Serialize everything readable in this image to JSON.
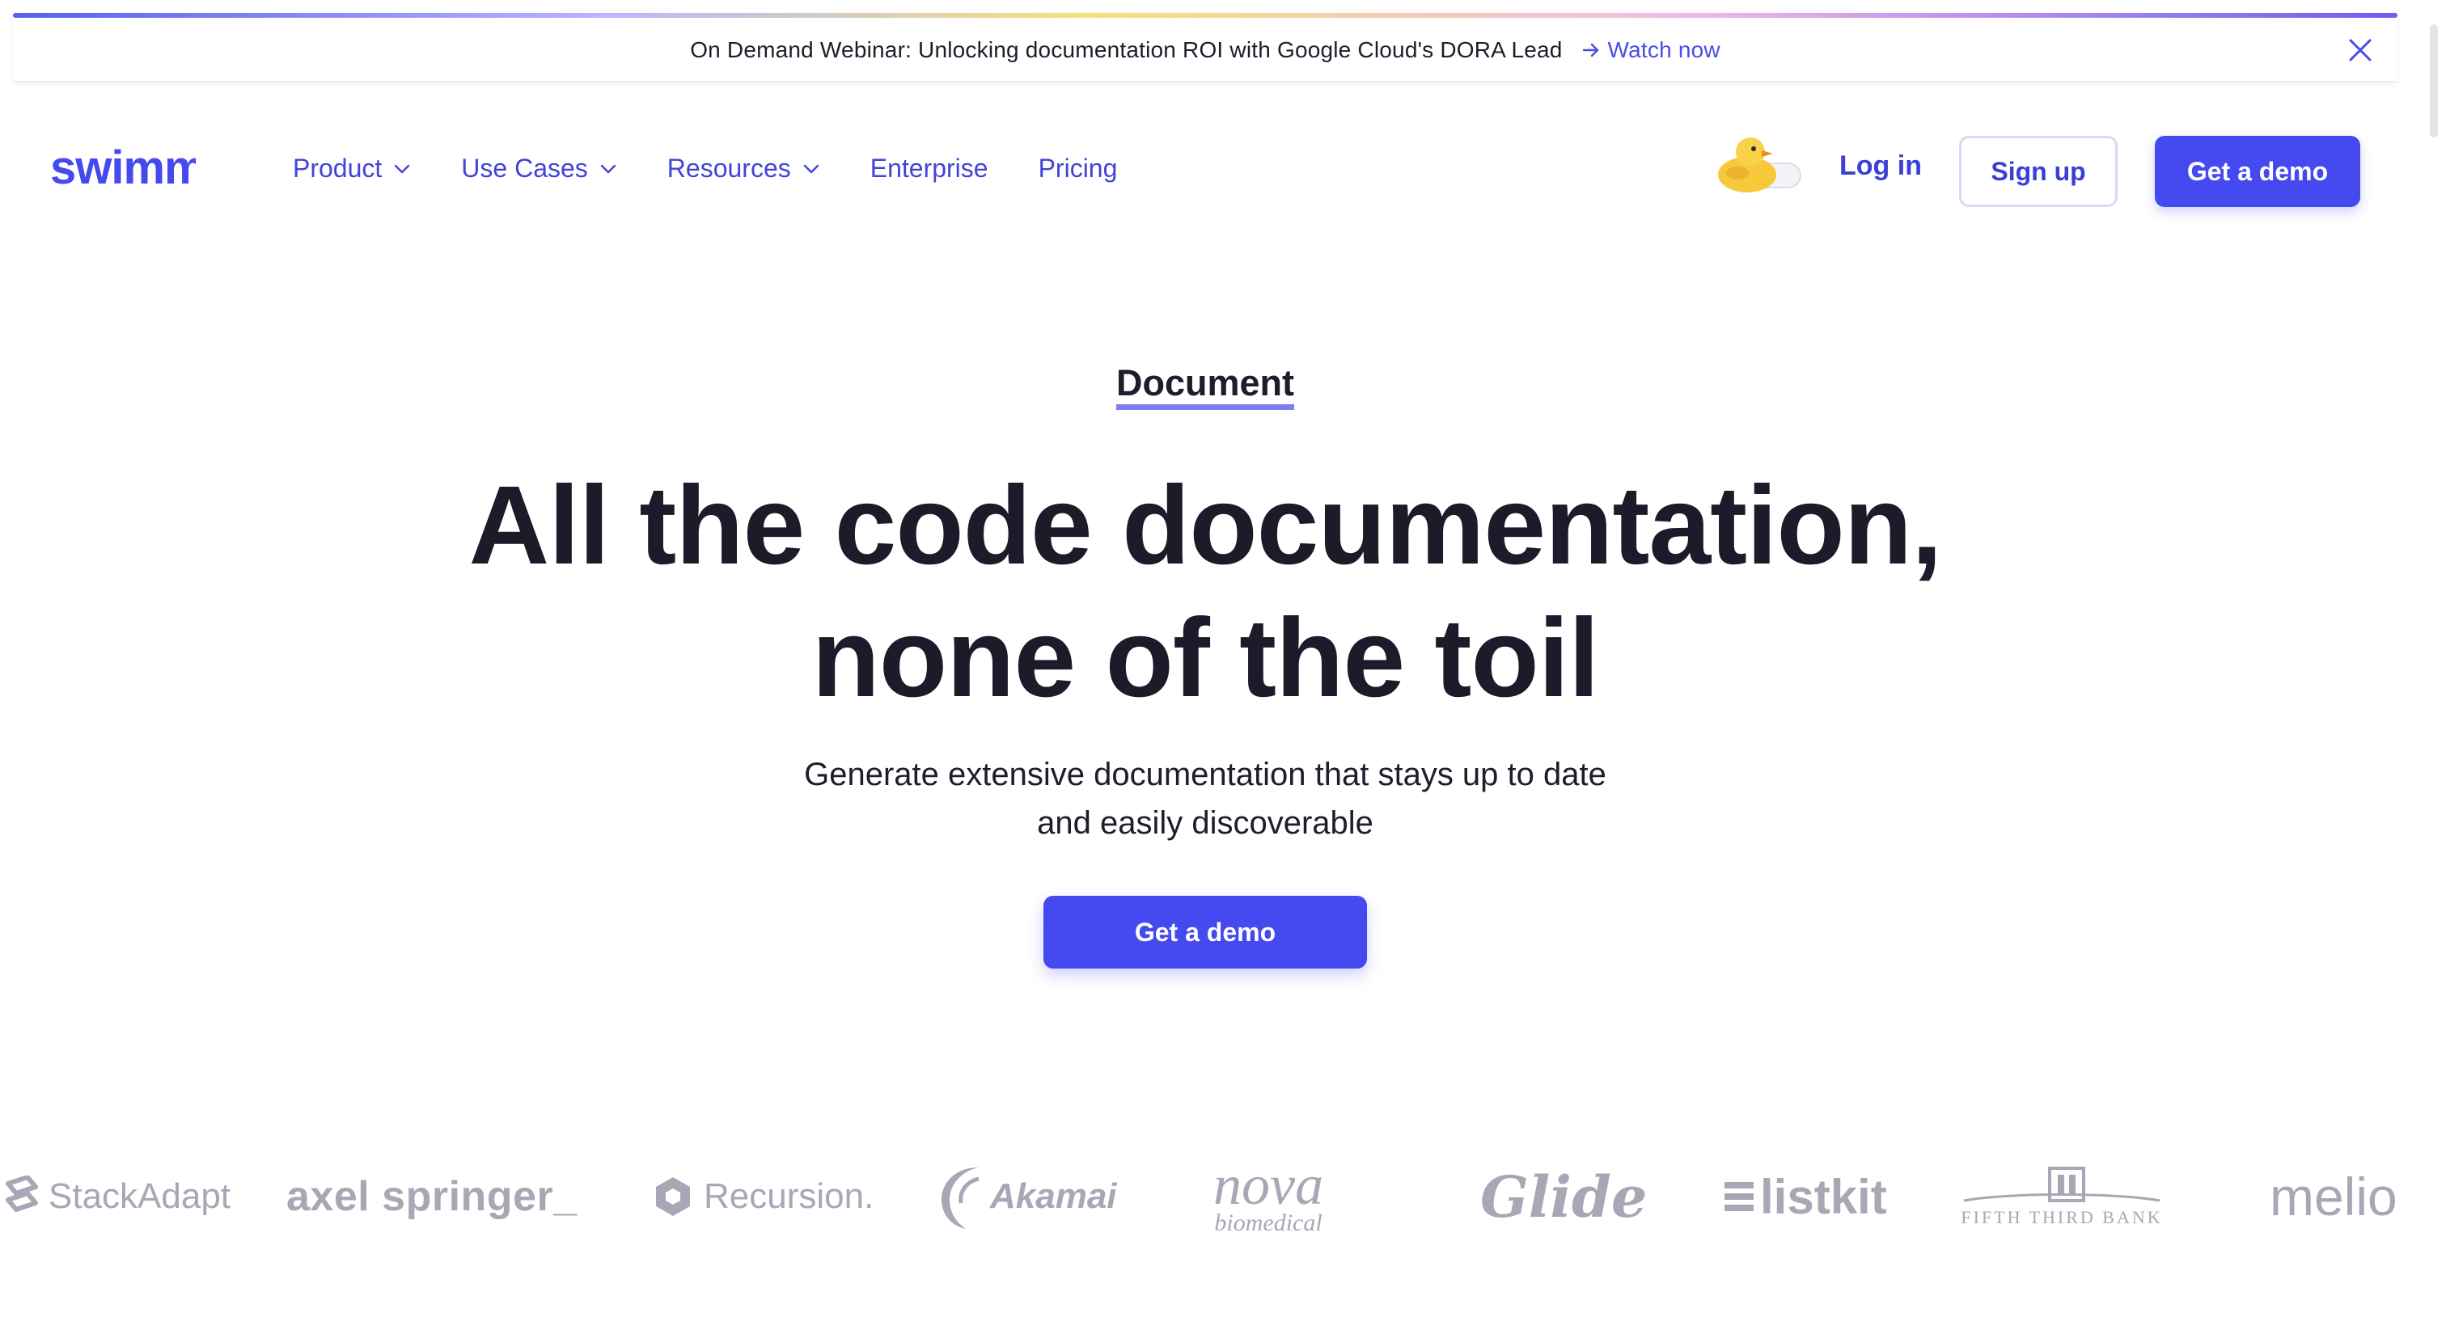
{
  "banner": {
    "text": "On Demand Webinar: Unlocking documentation ROI with Google Cloud's DORA Lead",
    "link_label": "Watch now",
    "icons": [
      "arrow-right-icon",
      "close-icon"
    ]
  },
  "nav": {
    "logo_text": "swimm",
    "items": [
      {
        "label": "Product",
        "has_dropdown": true
      },
      {
        "label": "Use Cases",
        "has_dropdown": true
      },
      {
        "label": "Resources",
        "has_dropdown": true
      },
      {
        "label": "Enterprise",
        "has_dropdown": false
      },
      {
        "label": "Pricing",
        "has_dropdown": false
      }
    ],
    "login_label": "Log in",
    "signup_label": "Sign up",
    "demo_label": "Get a demo"
  },
  "hero": {
    "eyebrow": "Document",
    "headline_line1": "All the code documentation,",
    "headline_line2": "none of the toil",
    "subhead_line1": "Generate extensive documentation that stays up to date",
    "subhead_line2": "and easily discoverable",
    "cta_label": "Get a demo"
  },
  "logos": {
    "stackadapt": "StackAdapt",
    "axel": "axel springer_",
    "recursion": "Recursion.",
    "akamai": "Akamai",
    "nova_big": "nova",
    "nova_small": "biomedical",
    "glide": "Glide",
    "listkit": "listkit",
    "fifth_third": "FIFTH THIRD BANK",
    "melio": "melio"
  },
  "colors": {
    "brand": "#4449f0",
    "nav_link": "#4244d8",
    "text_dark": "#1b1b29",
    "logo_gray": "#a7a7b6",
    "eyebrow_underline": "#7d7ff0"
  }
}
